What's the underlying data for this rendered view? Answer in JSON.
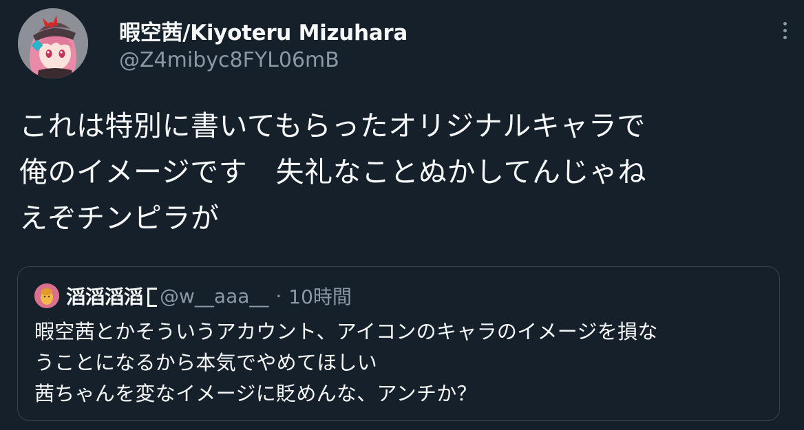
{
  "author": {
    "display_name": "暇空茜/Kiyoteru Mizuhara",
    "handle": "@Z4mibyc8FYL06mB",
    "avatar_icon": "anime-character-avatar-icon"
  },
  "more_icon": "more-vertical-icon",
  "tweet": {
    "text": "これは特別に書いてもらったオリジナルキャラで\n俺のイメージです　失礼なことぬかしてんじゃね\nえぞチンピラが"
  },
  "quote": {
    "display_name": "滔滔滔滔",
    "handle": "@w__aaa__",
    "separator": "·",
    "time": "10時間",
    "avatar_icon": "cartoon-avatar-icon",
    "text": "暇空茜とかそういうアカウント、アイコンのキャラのイメージを損な\nうことになるから本気でやめてほしい\n茜ちゃんを変なイメージに貶めんな、アンチか？"
  },
  "colors": {
    "background": "#15202b",
    "text_primary": "#f7f9f9",
    "text_secondary": "#8b98a5",
    "border": "#38444d"
  }
}
